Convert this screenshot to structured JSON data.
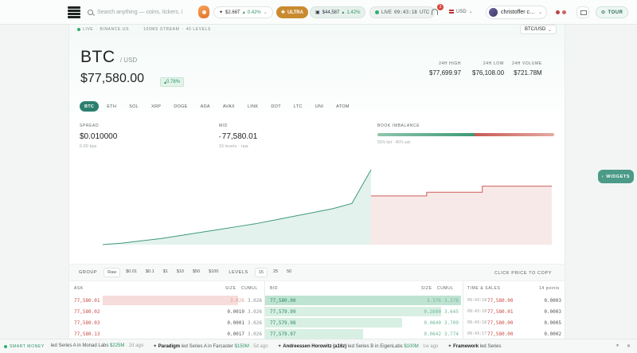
{
  "topbar": {
    "search_placeholder": "Search anything — coins, tickers, i",
    "stat_pill": {
      "value": "$2.66T",
      "change": "0.42%"
    },
    "ultra_label": "ULTRA",
    "balance": {
      "value": "$44,587",
      "change": "1.42%"
    },
    "live_clock": {
      "label": "LIVE",
      "time": "09:43:18",
      "tz": "UTC"
    },
    "notification_count": "3",
    "currency": "USD",
    "user_name": "christoffer c…",
    "tour_label": "TOUR"
  },
  "header": {
    "live_label": "LIVE",
    "exchange": "BINANCE.US",
    "stream_info": "100MS STREAM",
    "levels_info": "40 LEVELS",
    "pair_select": "BTC/USD",
    "symbol": "BTC",
    "quote": "/ USD",
    "price": "$77,580.00",
    "change": "0.78%",
    "high_label": "24H HIGH",
    "high": "$77,699.97",
    "low_label": "24H LOW",
    "low": "$76,108.00",
    "volume_label": "24H VOLUME",
    "volume": "$721.78M"
  },
  "asset_tabs": [
    "BTC",
    "ETH",
    "SOL",
    "XRP",
    "DOGE",
    "ADA",
    "AVAX",
    "LINK",
    "DOT",
    "LTC",
    "UNI",
    "ATOM"
  ],
  "metrics": {
    "spread_label": "SPREAD",
    "spread": "$0.010000",
    "spread_sub": "0.00 bps",
    "mid_label": "MID",
    "mid": "77,580.01",
    "mid_sub": "15 levels · raw",
    "imbalance_label": "BOOK IMBALANCE",
    "imbalance_sub": "55% bid · 45% ask",
    "imbalance_bid_fraction": 0.55
  },
  "chart_data": {
    "type": "area",
    "series": [
      {
        "values": [
          0.0,
          0.02,
          0.05,
          0.08,
          0.12,
          0.16,
          0.2,
          0.24,
          0.28,
          0.33,
          0.38,
          0.43,
          0.48,
          0.55,
          1.0
        ]
      },
      {
        "values": [
          0.65,
          0.65,
          0.65,
          0.65,
          0.7,
          0.7,
          0.7,
          0.7,
          0.78,
          0.78,
          0.78,
          0.78,
          0.78,
          0.78
        ]
      }
    ],
    "colors": {
      "bid": "#3e9a76",
      "ask": "#c9605a"
    }
  },
  "controls": {
    "group_label": "GROUP",
    "group_options": [
      "Raw",
      "$0.01",
      "$0.1",
      "$1",
      "$10",
      "$50",
      "$100"
    ],
    "group_active": "Raw",
    "levels_label": "LEVELS",
    "levels_options": [
      "15",
      "25",
      "50"
    ],
    "levels_active": "15",
    "copy_hint": "CLICK PRICE TO COPY"
  },
  "book": {
    "ask_label": "ASK",
    "bid_label": "BID",
    "size_label": "SIZE",
    "cumul_label": "CUMUL",
    "asks": [
      {
        "price": "77,580.01",
        "size": "3.026",
        "cumul": "3.026",
        "fill": 0.85
      },
      {
        "price": "77,580.02",
        "size": "0.0010",
        "cumul": "3.026",
        "fill": 0.0
      },
      {
        "price": "77,580.03",
        "size": "0.0001",
        "cumul": "3.026",
        "fill": 0.0
      },
      {
        "price": "77,580.13",
        "size": "0.0017",
        "cumul": "3.026",
        "fill": 0.0
      }
    ],
    "bids": [
      {
        "price": "77,580.00",
        "size": "3.376",
        "cumul": "3.376",
        "fill": 1.0
      },
      {
        "price": "77,579.99",
        "size": "0.2690",
        "cumul": "3.645",
        "fill": 0.9
      },
      {
        "price": "77,579.98",
        "size": "0.0640",
        "cumul": "3.709",
        "fill": 0.7
      },
      {
        "price": "77,579.97",
        "size": "0.0642",
        "cumul": "3.774",
        "fill": 0.5
      }
    ],
    "trades_label": "TIME & SALES",
    "trades_points": "14 points",
    "trades": [
      {
        "time": "09:43:18",
        "price": "77,580.00",
        "size": "0.0003"
      },
      {
        "time": "09:43:18",
        "price": "77,580.01",
        "size": "0.0003"
      },
      {
        "time": "09:43:18",
        "price": "77,580.00",
        "size": "0.0005"
      },
      {
        "time": "09:43:17",
        "price": "77,580.00",
        "size": "0.0002"
      }
    ]
  },
  "widgets_label": "WIDGETS",
  "news": {
    "tag": "SMART MONEY",
    "items": [
      {
        "who": "",
        "text": "led Series A in Monad Labs",
        "amount": "$225M",
        "ago": "2d ago"
      },
      {
        "who": "Paradigm",
        "text": "led Series A in Farcaster",
        "amount": "$150M",
        "ago": "5d ago"
      },
      {
        "who": "Andreessen Horowitz (a16z)",
        "text": "led Series B in EigenLabs",
        "amount": "$100M",
        "ago": "1w ago"
      },
      {
        "who": "Framework",
        "text": "led Series",
        "amount": "",
        "ago": ""
      }
    ]
  }
}
